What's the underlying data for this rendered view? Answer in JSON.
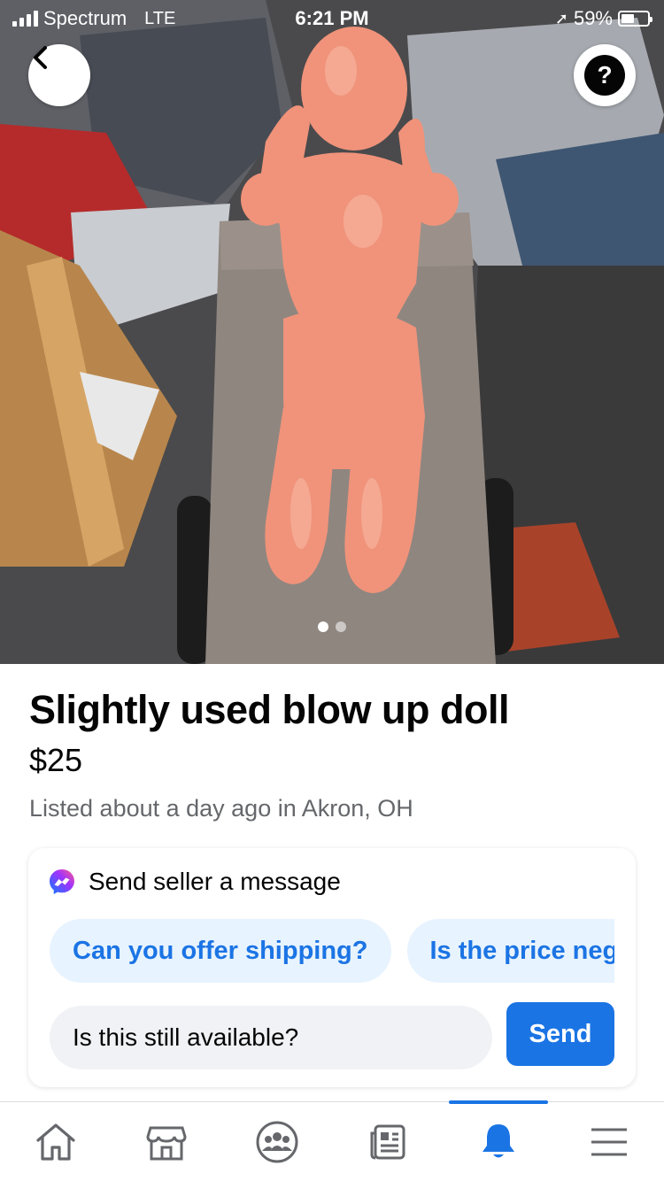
{
  "status_bar": {
    "carrier": "Spectrum",
    "network": "LTE",
    "time": "6:21 PM",
    "battery": "59%"
  },
  "photo": {
    "image_count": 2,
    "active_index": 0
  },
  "listing": {
    "title": "Slightly used blow up doll",
    "price": "$25",
    "meta": "Listed about a day ago in Akron, OH"
  },
  "message": {
    "heading": "Send seller a message",
    "suggestions": [
      "Can you offer shipping?",
      "Is the price negotiable?"
    ],
    "input_value": "Is this still available?",
    "send_label": "Send"
  },
  "tabs": [
    {
      "name": "home",
      "icon": "home-icon",
      "active": false
    },
    {
      "name": "marketplace",
      "icon": "marketplace-icon",
      "active": false
    },
    {
      "name": "groups",
      "icon": "groups-icon",
      "active": false
    },
    {
      "name": "news",
      "icon": "news-icon",
      "active": false
    },
    {
      "name": "notifications",
      "icon": "bell-icon",
      "active": true
    },
    {
      "name": "menu",
      "icon": "menu-icon",
      "active": false
    }
  ],
  "colors": {
    "accent": "#1b74e4",
    "chip_bg": "#e7f3ff",
    "secondary_text": "#65676b"
  }
}
